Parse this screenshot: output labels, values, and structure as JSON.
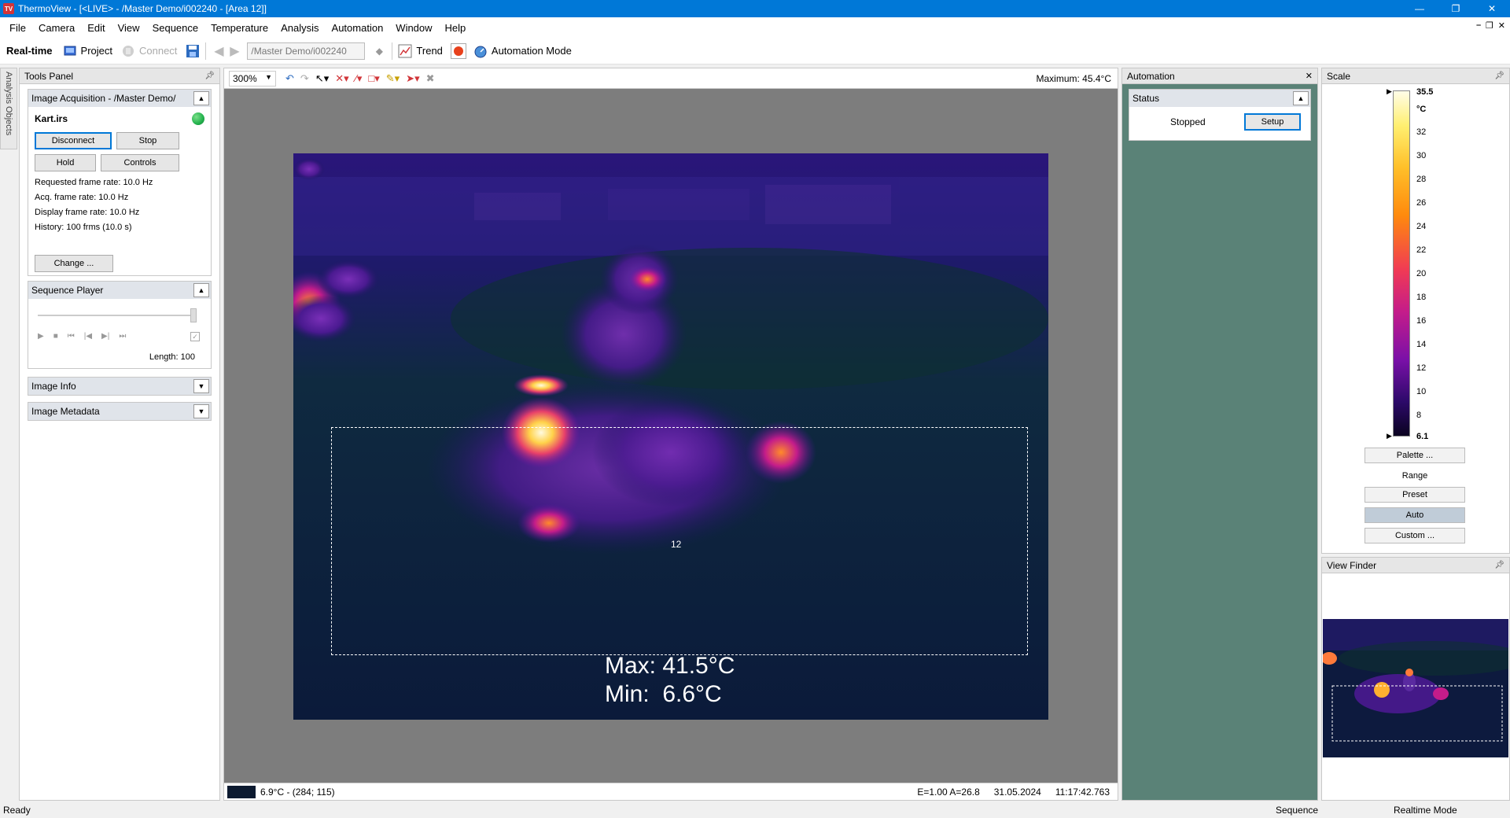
{
  "window": {
    "title": "ThermoView - [<LIVE> - /Master Demo/i002240 - [Area 12]]",
    "app_icon_text": "TV"
  },
  "menu": [
    "File",
    "Camera",
    "Edit",
    "View",
    "Sequence",
    "Temperature",
    "Analysis",
    "Automation",
    "Window",
    "Help"
  ],
  "toolbar": {
    "realtime_label": "Real-time",
    "project_label": "Project",
    "connect_label": "Connect",
    "path_value": "/Master Demo/i002240",
    "trend_label": "Trend",
    "automation_mode_label": "Automation Mode"
  },
  "side_tab": {
    "label": "Analysis Objects"
  },
  "tools_panel": {
    "title": "Tools Panel",
    "acquisition": {
      "header": "Image Acquisition - /Master Demo/",
      "file_name": "Kart.irs",
      "disconnect_label": "Disconnect",
      "stop_label": "Stop",
      "hold_label": "Hold",
      "controls_label": "Controls",
      "requested_rate": "Requested frame rate: 10.0 Hz",
      "acq_rate": "Acq. frame rate: 10.0 Hz",
      "display_rate": "Display frame rate: 10.0 Hz",
      "history": "History: 100 frms (10.0 s)",
      "change_label": "Change ...",
      "status_color": "#22b14c"
    },
    "sequence_player": {
      "header": "Sequence Player",
      "length_label": "Length: 100"
    },
    "image_info": {
      "header": "Image Info"
    },
    "image_metadata": {
      "header": "Image Metadata"
    }
  },
  "main_view": {
    "zoom": "300%",
    "maximum_label": "Maximum: 45.4°C",
    "area_label": "12",
    "max_overlay": "Max: 41.5°C",
    "min_overlay": "Min:  6.6°C",
    "status_temp": "6.9°C - (284; 115)",
    "status_emissivity": "E=1.00 A=26.8",
    "status_date": "31.05.2024",
    "status_time": "11:17:42.763"
  },
  "automation_panel": {
    "title": "Automation",
    "status_header": "Status",
    "status_value": "Stopped",
    "setup_label": "Setup"
  },
  "scale_panel": {
    "title": "Scale",
    "max_value": "35.5",
    "unit": "°C",
    "ticks": [
      "32",
      "30",
      "28",
      "26",
      "24",
      "22",
      "20",
      "18",
      "16",
      "14",
      "12",
      "10",
      "8"
    ],
    "min_value": "6.1",
    "palette_label": "Palette ...",
    "range_label": "Range",
    "preset_label": "Preset",
    "auto_label": "Auto",
    "custom_label": "Custom ..."
  },
  "view_finder": {
    "title": "View Finder"
  },
  "statusbar": {
    "ready": "Ready",
    "sequence": "Sequence",
    "mode": "Realtime Mode"
  }
}
